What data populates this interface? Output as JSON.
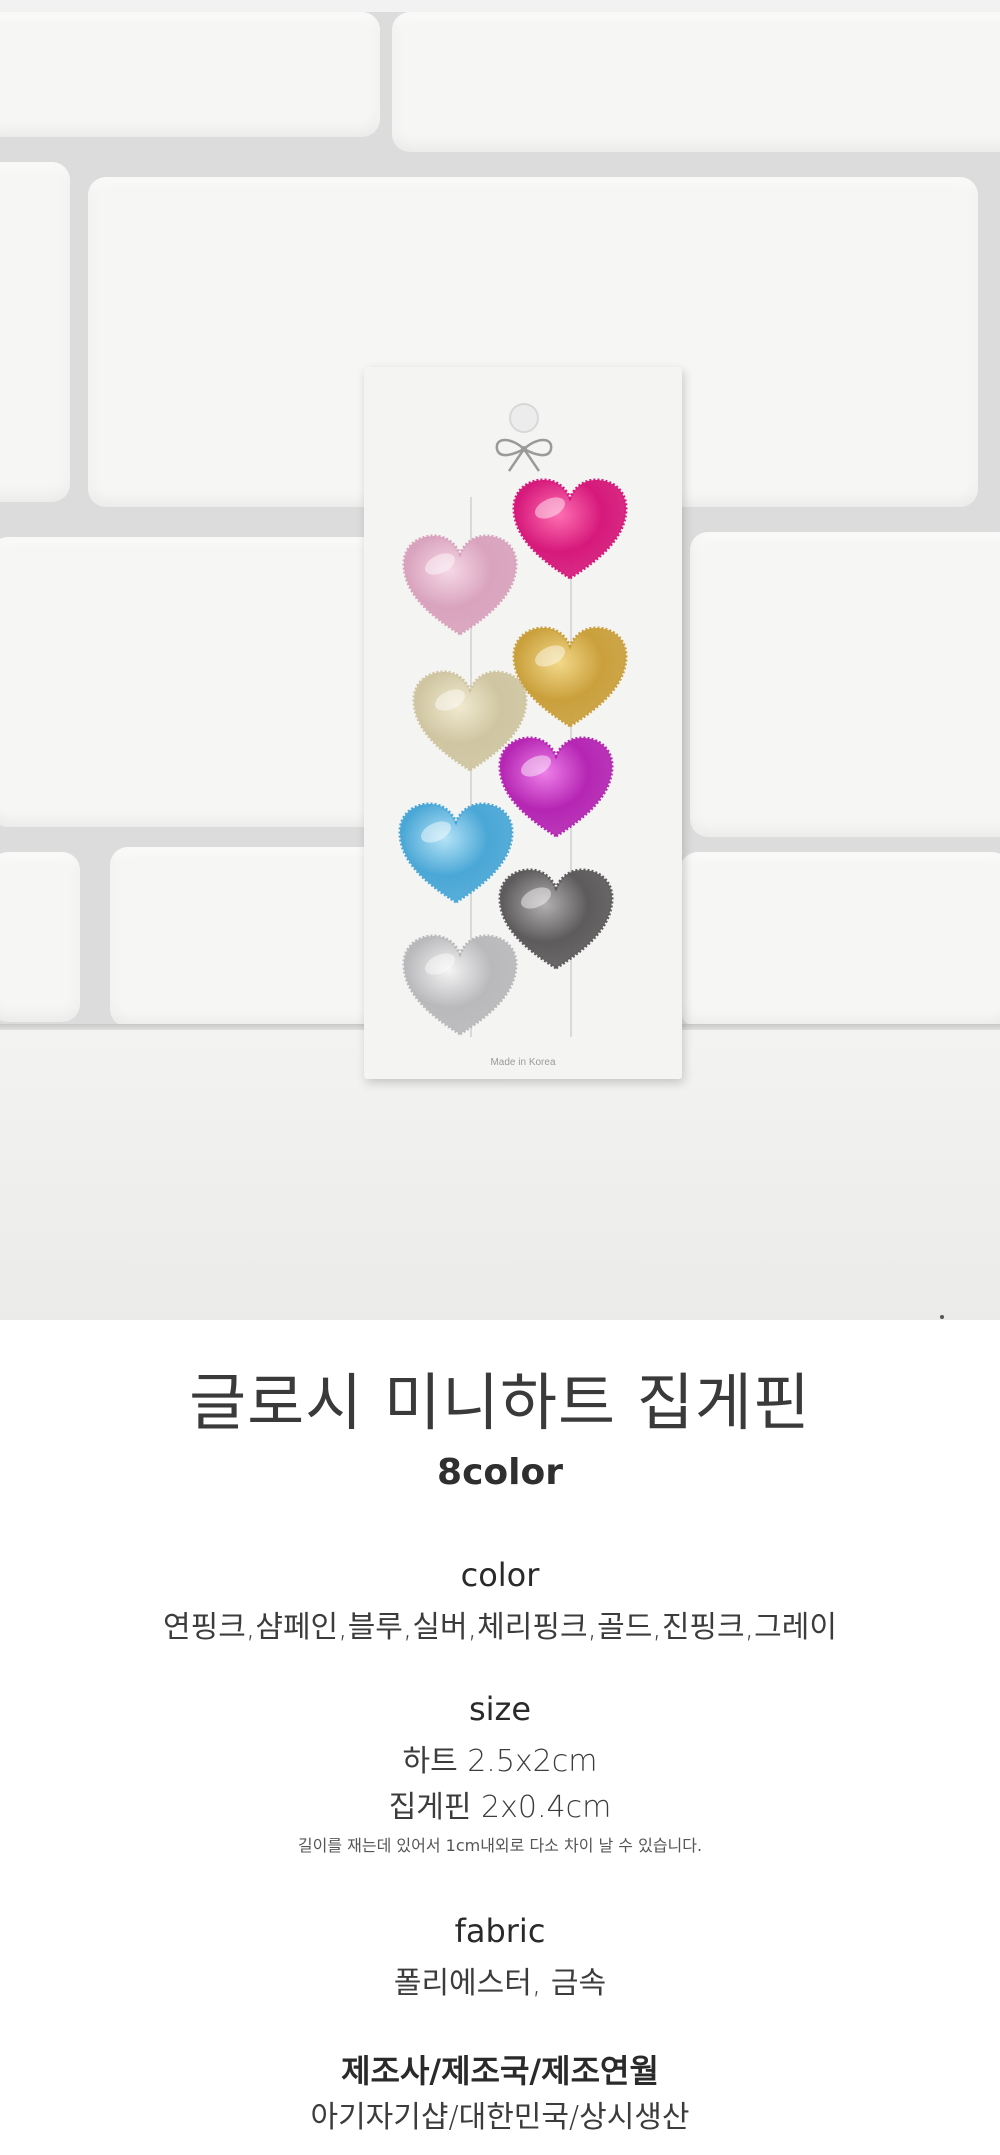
{
  "photo": {
    "card_text": "Made in Korea",
    "hearts": [
      {
        "name": "heart-cherry-pink",
        "color": "#d6197b",
        "highlight": "#ff6fb2"
      },
      {
        "name": "heart-light-pink",
        "color": "#d9a3bd",
        "highlight": "#f6d8e6"
      },
      {
        "name": "heart-gold",
        "color": "#caa03c",
        "highlight": "#f3d98a"
      },
      {
        "name": "heart-champagne",
        "color": "#cfc5a1",
        "highlight": "#f1ead0"
      },
      {
        "name": "heart-deep-pink",
        "color": "#b526b3",
        "highlight": "#ee7fe9"
      },
      {
        "name": "heart-blue",
        "color": "#4aa7d6",
        "highlight": "#b5e3f7"
      },
      {
        "name": "heart-gray",
        "color": "#5e5b5d",
        "highlight": "#b3b0b2"
      },
      {
        "name": "heart-silver",
        "color": "#b9b9bb",
        "highlight": "#f4f4f5"
      }
    ]
  },
  "product": {
    "title": "글로시 미니하트 집게핀",
    "subtitle": "8color"
  },
  "specs": {
    "color_label": "color",
    "color_value": "연핑크,샴페인,블루,실버,체리핑크,골드,진핑크,그레이",
    "size_label": "size",
    "size_heart": "하트 2.5x2cm",
    "size_pin": "집게핀 2x0.4cm",
    "size_note": "길이를 재는데 있어서 1cm내외로 다소 차이 날 수 있습니다.",
    "fabric_label": "fabric",
    "fabric_value": "폴리에스터, 금속",
    "maker_label": "제조사/제조국/제조연월",
    "maker_value": "아기자기샵/대한민국/상시생산"
  }
}
